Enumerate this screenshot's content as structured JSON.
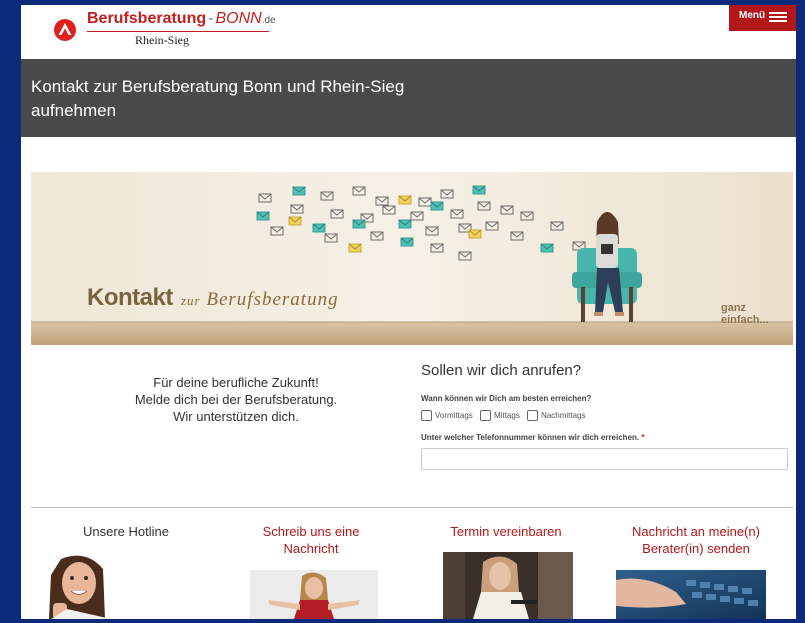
{
  "header": {
    "logo_title": "Berufsberatung",
    "logo_sep": "-",
    "logo_city": "BONN",
    "logo_tld": ".de",
    "logo_sub": "Rhein-Sieg",
    "menu_label": "Menü"
  },
  "page_title": "Kontakt zur Berufsberatung Bonn und Rhein-Sieg aufnehmen",
  "banner": {
    "headline": "Kontakt",
    "script_small": "zur",
    "script": "Berufsberatung",
    "tagline": "ganz einfach..."
  },
  "intro": {
    "line1": "Für deine berufliche Zukunft!",
    "line2": "Melde dich bei der Berufsberatung.",
    "line3": "Wir unterstützen dich."
  },
  "callback_form": {
    "title": "Sollen wir dich anrufen?",
    "question_time": "Wann können wir Dich am besten erreichen?",
    "options": [
      "Vormittags",
      "Mittags",
      "Nachmittags"
    ],
    "question_phone": "Unter welcher Telefonnummer können wir dich erreichen.",
    "required_mark": "*",
    "phone_value": ""
  },
  "cards": [
    {
      "title": "Unsere Hotline",
      "color": "#333333"
    },
    {
      "title": "Schreib uns eine Nachricht",
      "color": "#b3171a"
    },
    {
      "title": "Termin vereinbaren",
      "color": "#b3171a"
    },
    {
      "title": "Nachricht an meine(n) Berater(in) senden",
      "color": "#b3171a"
    }
  ],
  "colors": {
    "brand_red": "#b3171a",
    "title_band": "#4a4a4a"
  }
}
